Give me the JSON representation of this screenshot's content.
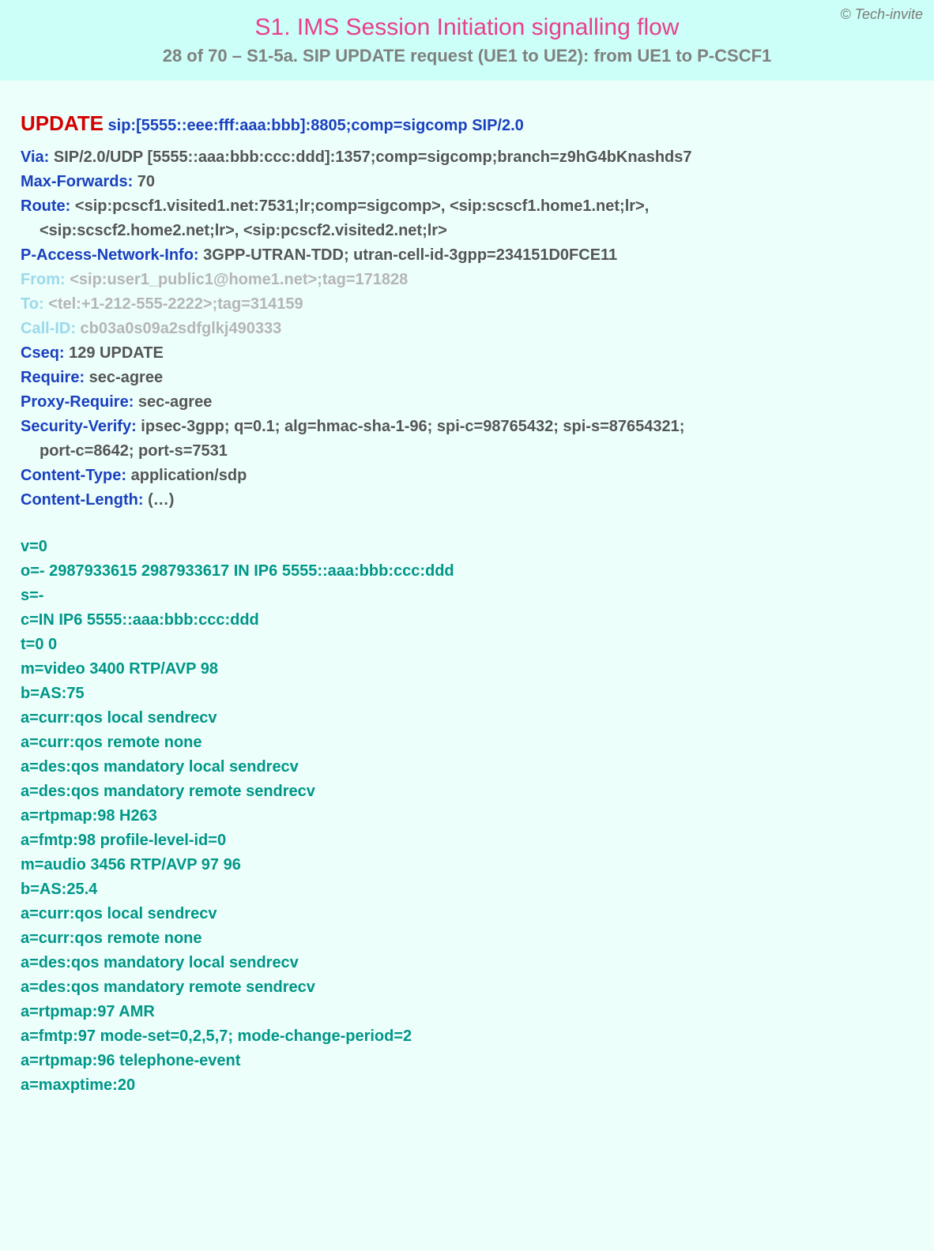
{
  "copyright": "© Tech-invite",
  "title": "S1.  IMS Session Initiation signalling flow",
  "subtitle": "28 of 70 – S1-5a. SIP UPDATE request (UE1 to UE2): from UE1 to P-CSCF1",
  "request": {
    "method": "UPDATE",
    "uri": "sip:[5555::eee:fff:aaa:bbb]:8805;comp=sigcomp SIP/2.0"
  },
  "headers": [
    {
      "name": "Via",
      "value": "SIP/2.0/UDP [5555::aaa:bbb:ccc:ddd]:1357;comp=sigcomp;branch=z9hG4bKnashds7",
      "faded": false
    },
    {
      "name": "Max-Forwards",
      "value": "70",
      "faded": false
    },
    {
      "name": "Route",
      "value": "<sip:pcscf1.visited1.net:7531;lr;comp=sigcomp>, <sip:scscf1.home1.net;lr>,",
      "faded": false,
      "cont": "<sip:scscf2.home2.net;lr>, <sip:pcscf2.visited2.net;lr>"
    },
    {
      "name": "P-Access-Network-Info",
      "value": "3GPP-UTRAN-TDD; utran-cell-id-3gpp=234151D0FCE11",
      "faded": false
    },
    {
      "name": "From",
      "value": "<sip:user1_public1@home1.net>;tag=171828",
      "faded": true
    },
    {
      "name": "To",
      "value": "<tel:+1-212-555-2222>;tag=314159",
      "faded": true
    },
    {
      "name": "Call-ID",
      "value": "cb03a0s09a2sdfglkj490333",
      "faded": true
    },
    {
      "name": "Cseq",
      "value": "129 UPDATE",
      "faded": false
    },
    {
      "name": "Require",
      "value": "sec-agree",
      "faded": false
    },
    {
      "name": "Proxy-Require",
      "value": "sec-agree",
      "faded": false
    },
    {
      "name": "Security-Verify",
      "value": "ipsec-3gpp; q=0.1; alg=hmac-sha-1-96; spi-c=98765432; spi-s=87654321;",
      "faded": false,
      "cont": "port-c=8642; port-s=7531"
    },
    {
      "name": "Content-Type",
      "value": "application/sdp",
      "faded": false
    },
    {
      "name": "Content-Length",
      "value": "(…)",
      "faded": false
    }
  ],
  "sdp": [
    "v=0",
    "o=- 2987933615 2987933617 IN IP6 5555::aaa:bbb:ccc:ddd",
    "s=-",
    "c=IN IP6 5555::aaa:bbb:ccc:ddd",
    "t=0 0",
    "m=video 3400 RTP/AVP 98",
    "b=AS:75",
    "a=curr:qos local sendrecv",
    "a=curr:qos remote none",
    "a=des:qos mandatory local sendrecv",
    "a=des:qos mandatory remote sendrecv",
    "a=rtpmap:98 H263",
    "a=fmtp:98 profile-level-id=0",
    "m=audio 3456 RTP/AVP 97 96",
    "b=AS:25.4",
    "a=curr:qos local sendrecv",
    "a=curr:qos remote none",
    "a=des:qos mandatory local sendrecv",
    "a=des:qos mandatory remote sendrecv",
    "a=rtpmap:97 AMR",
    "a=fmtp:97 mode-set=0,2,5,7; mode-change-period=2",
    "a=rtpmap:96 telephone-event",
    "a=maxptime:20"
  ]
}
